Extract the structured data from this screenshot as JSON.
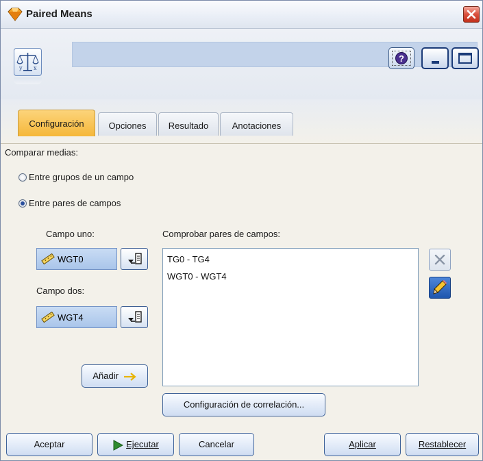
{
  "window": {
    "title": "Paired Means"
  },
  "tabs": [
    {
      "label": "Configuración",
      "active": true
    },
    {
      "label": "Opciones",
      "active": false
    },
    {
      "label": "Resultado",
      "active": false
    },
    {
      "label": "Anotaciones",
      "active": false
    }
  ],
  "settings": {
    "compare_label": "Comparar medias:",
    "radio_between_groups": "Entre grupos de un campo",
    "radio_between_pairs": "Entre pares de campos",
    "field_one_label": "Campo uno:",
    "field_one_value": "WGT0",
    "field_two_label": "Campo dos:",
    "field_two_value": "WGT4",
    "pairs_label": "Comprobar pares de campos:",
    "pairs": [
      "TG0 - TG4",
      "WGT0 - WGT4"
    ],
    "add_button": "Añadir",
    "correlation_button": "Configuración de correlación..."
  },
  "footer": {
    "ok": "Aceptar",
    "run": "Ejecutar",
    "cancel": "Cancelar",
    "apply": "Aplicar",
    "reset": "Restablecer"
  },
  "colors": {
    "active_tab": "#f5b73a",
    "field_select": "#b6cff0",
    "accent": "#3f6399"
  },
  "icons": {
    "app": "diamond-node-icon",
    "node": "scales-icon",
    "help": "help-icon",
    "field": "ruler-icon",
    "picker": "field-picker-icon",
    "delete": "delete-x-icon",
    "edit": "pencil-icon",
    "add_arrow": "arrow-right-icon",
    "run": "play-icon"
  }
}
